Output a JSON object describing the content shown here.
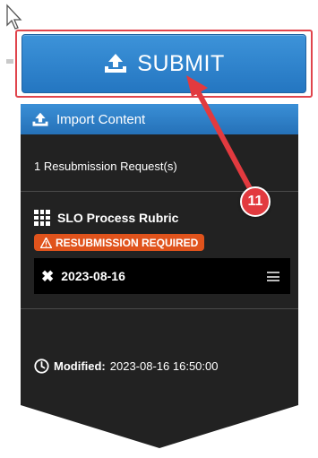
{
  "submit": {
    "label": "SUBMIT",
    "icon": "upload-icon"
  },
  "panel": {
    "header": {
      "label": "Import Content",
      "icon": "upload-icon"
    },
    "resubmission_count": "1 Resubmission Request(s)",
    "rubric": {
      "title": "SLO Process Rubric",
      "icon": "grid-icon",
      "badge": "RESUBMISSION REQUIRED",
      "date": "2023-08-16"
    },
    "modified": {
      "label": "Modified:",
      "value": "2023-08-16 16:50:00"
    }
  },
  "annotation": {
    "step": "11"
  },
  "colors": {
    "accent": "#2a7fca",
    "badge": "#e0531c",
    "annotation": "#e23a3f",
    "panel": "#222222"
  }
}
